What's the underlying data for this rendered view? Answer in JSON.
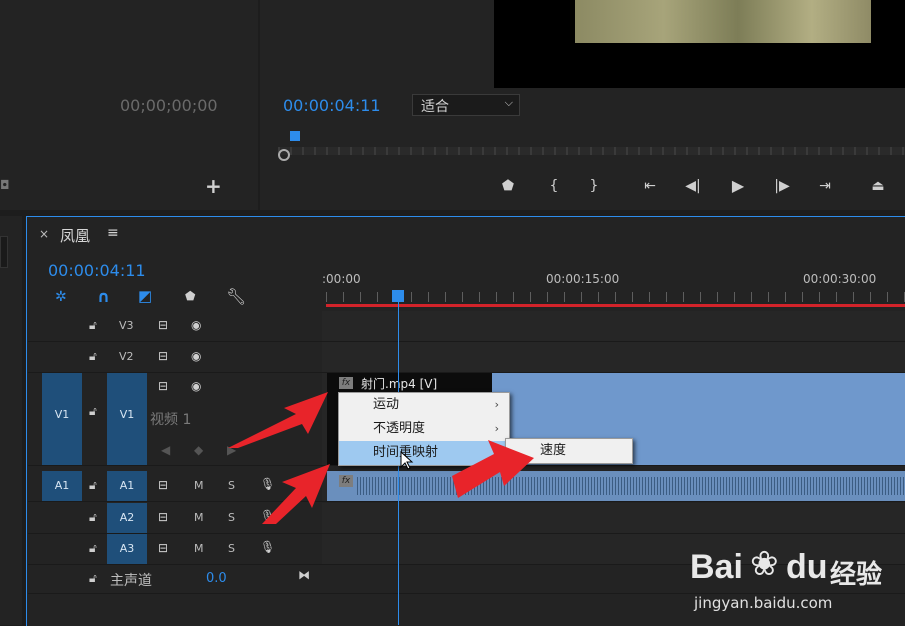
{
  "source_monitor": {
    "timecode": "00;00;00;00"
  },
  "program_monitor": {
    "timecode": "00:00:04:11",
    "fit_label": "适合",
    "transport_icons": [
      "marker-icon",
      "mark-in-icon",
      "mark-out-icon",
      "go-to-in-icon",
      "step-back-icon",
      "play-icon",
      "step-forward-icon",
      "go-to-out-icon",
      "lift-icon"
    ]
  },
  "timeline": {
    "tab_name": "凤凰",
    "timecode": "00:00:04:11",
    "ruler_labels": [
      ":00:00",
      "00:00:15:00",
      "00:00:30:00"
    ],
    "tracks": {
      "v3": "V3",
      "v2": "V2",
      "v1": "V1",
      "v1_source": "V1",
      "v1_name": "视频 1",
      "a1": "A1",
      "a1_source": "A1",
      "a2": "A2",
      "a3": "A3",
      "mute": "M",
      "solo": "S",
      "master_label": "主声道",
      "master_value": "0.0"
    },
    "clip_label": "射门.mp4 [V]",
    "fx_badge": "fx"
  },
  "context_menu": {
    "items": [
      {
        "label": "运动",
        "has_submenu": true
      },
      {
        "label": "不透明度",
        "has_submenu": true
      },
      {
        "label": "时间重映射",
        "has_submenu": true,
        "highlighted": true
      }
    ],
    "submenu": {
      "label": "速度"
    }
  },
  "watermark": {
    "brand_left": "Bai",
    "brand_right": "du",
    "brand_cn": "经验",
    "url": "jingyan.baidu.com"
  },
  "colors": {
    "accent": "#2d8ceb",
    "clip_video": "#6f98cc",
    "clip_audio": "#6a8fbd",
    "annotation_arrow": "#e8242a"
  }
}
